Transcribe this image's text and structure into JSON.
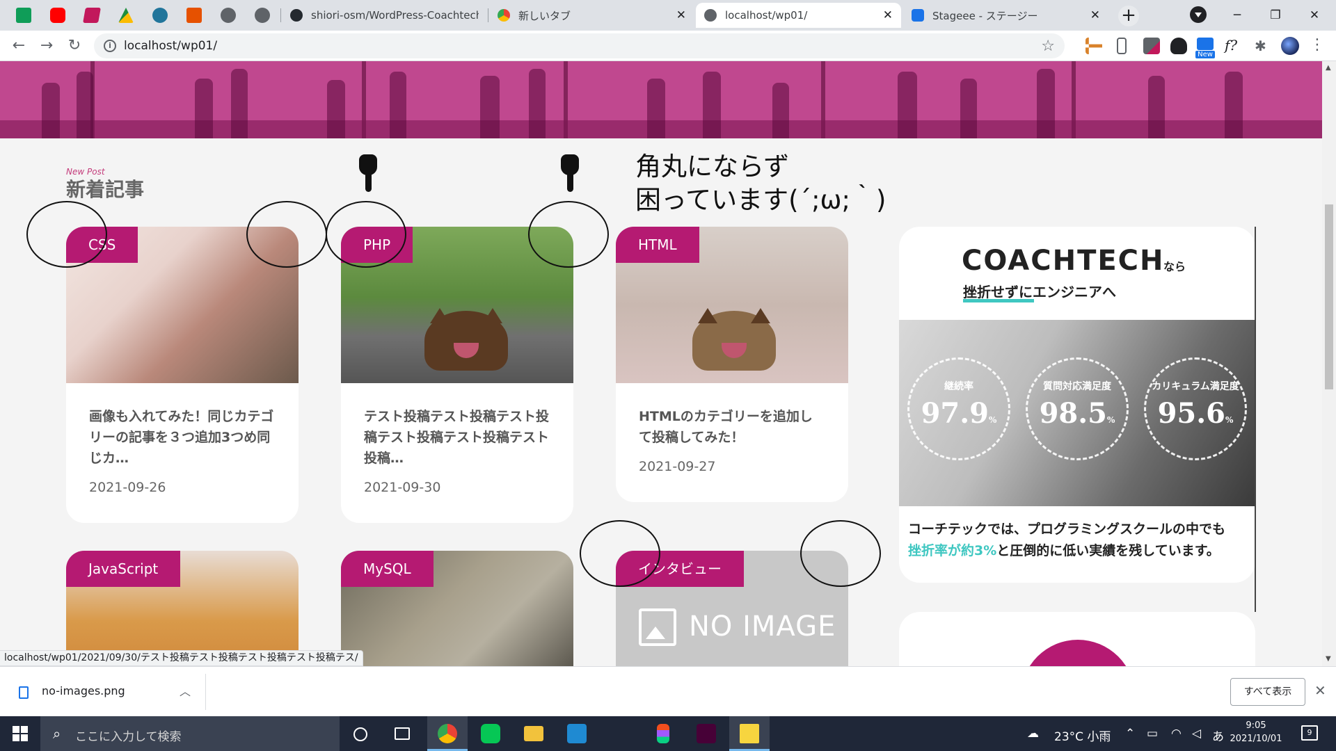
{
  "browser": {
    "pinned_tabs": [
      {
        "icon": "google-sheets-icon",
        "color": "#0f9d58"
      },
      {
        "icon": "youtube-icon",
        "color": "#ff0000"
      },
      {
        "icon": "bookmark-app-icon",
        "color": "#c2185b"
      },
      {
        "icon": "drive-icon",
        "color": "#1e8e3e"
      },
      {
        "icon": "wordpress-icon",
        "color": "#21759b"
      },
      {
        "icon": "html-icon",
        "color": "#e65100"
      },
      {
        "icon": "globe-icon",
        "color": "#5f6368"
      },
      {
        "icon": "globe-icon",
        "color": "#5f6368"
      }
    ],
    "tabs": [
      {
        "title": "shiori-osm/WordPress-Coachtech",
        "icon": "github-icon"
      },
      {
        "title": "新しいタブ",
        "icon": "chrome-icon"
      },
      {
        "title": "localhost/wp01/",
        "icon": "globe-icon",
        "active": true
      },
      {
        "title": "Stageee - ステージー",
        "icon": "stageee-icon"
      }
    ],
    "url": "localhost/wp01/",
    "status_url": "localhost/wp01/2021/09/30/テスト投稿テスト投稿テスト投稿テスト投稿テス/"
  },
  "page": {
    "section_sub": "New Post",
    "section_title": "新着記事",
    "cards": [
      {
        "category": "CSS",
        "title": "画像も入れてみた！同じカテゴリーの記事を３つ追加3つめ同じカ…",
        "date": "2021-09-26"
      },
      {
        "category": "PHP",
        "title": "テスト投稿テスト投稿テスト投稿テスト投稿テスト投稿テスト投稿…",
        "date": "2021-09-30"
      },
      {
        "category": "HTML",
        "title": "HTMLのカテゴリーを追加して投稿してみた！",
        "date": "2021-09-27"
      },
      {
        "category": "JavaScript"
      },
      {
        "category": "MySQL"
      },
      {
        "category": "インタビュー",
        "no_image_text": "NO IMAGE"
      }
    ],
    "annotation": [
      "角丸にならず",
      "困っています(´;ω;｀)"
    ],
    "sidebar_ad": {
      "logo": "COACHTECH",
      "logo_suffix": "なら",
      "tagline": "挫折せずにエンジニアへ",
      "stats": [
        {
          "label": "継続率",
          "value": "97.9",
          "unit": "%"
        },
        {
          "label": "質問対応満足度",
          "value": "98.5",
          "unit": "%"
        },
        {
          "label": "カリキュラム満足度",
          "value": "95.6",
          "unit": "%"
        }
      ],
      "copy_1": "コーチテックでは、プログラミングスクールの中でも",
      "copy_accent": "挫折率が約3%",
      "copy_2": "と圧倒的に低い実績を残しています。",
      "accent_color": "#3fc7c1"
    },
    "brand_color": "#b51a72"
  },
  "download_shelf": {
    "filename": "no-images.png",
    "show_all": "すべて表示"
  },
  "taskbar": {
    "search_placeholder": "ここに入力して検索",
    "weather": "23°C 小雨",
    "ime": "あ",
    "time": "9:05",
    "date": "2021/10/01",
    "notifications": "9"
  }
}
